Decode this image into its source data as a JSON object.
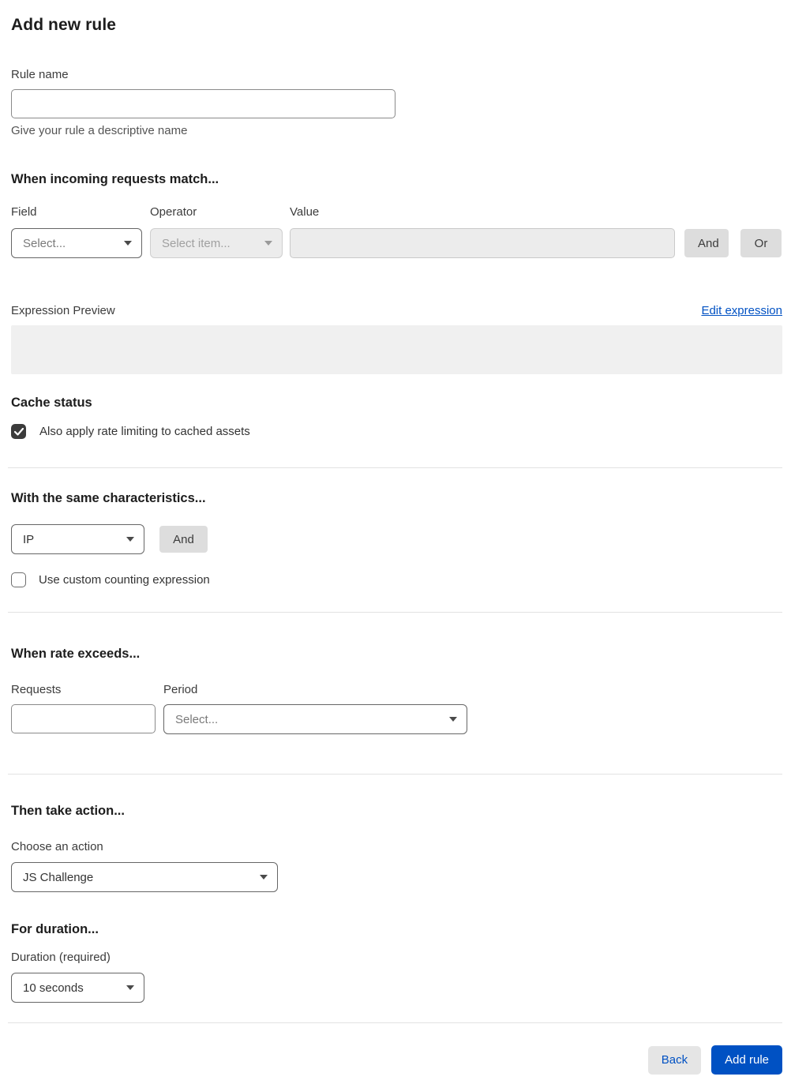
{
  "page": {
    "title": "Add new rule"
  },
  "rule_name": {
    "label": "Rule name",
    "value": "",
    "helper": "Give your rule a descriptive name"
  },
  "match": {
    "header": "When incoming requests match...",
    "field": {
      "label": "Field",
      "selected": "Select..."
    },
    "operator": {
      "label": "Operator",
      "selected": "Select item..."
    },
    "value": {
      "label": "Value",
      "value": ""
    },
    "and_label": "And",
    "or_label": "Or"
  },
  "expression": {
    "label": "Expression Preview",
    "edit_link": "Edit expression",
    "preview_text": ""
  },
  "cache": {
    "header": "Cache status",
    "checkbox_label": "Also apply rate limiting to cached assets",
    "checked": true
  },
  "characteristics": {
    "header": "With the same characteristics...",
    "selected": "IP",
    "and_label": "And",
    "checkbox_label": "Use custom counting expression",
    "checked": false
  },
  "rate": {
    "header": "When rate exceeds...",
    "requests_label": "Requests",
    "requests_value": "",
    "period_label": "Period",
    "period_selected": "Select..."
  },
  "action": {
    "header": "Then take action...",
    "choose_label": "Choose an action",
    "selected": "JS Challenge"
  },
  "duration": {
    "header": "For duration...",
    "label": "Duration (required)",
    "selected": "10 seconds"
  },
  "footer": {
    "back_label": "Back",
    "submit_label": "Add rule"
  },
  "colors": {
    "accent_blue": "#0051c3",
    "button_gray": "#dddddd",
    "disabled_bg": "#ececec",
    "checkbox_dark": "#3b3b3b",
    "preview_bg": "#f0f0f0"
  },
  "icons": {
    "dropdown_caret": "caret-down-icon",
    "checkmark": "checkmark-icon"
  }
}
